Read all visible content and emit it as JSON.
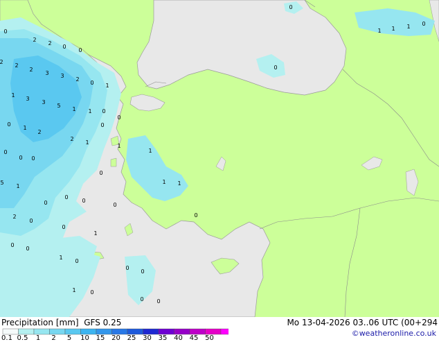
{
  "legend": {
    "title": "Precipitation [mm]",
    "model": "GFS 0.25",
    "valid_time": "Mo 13-04-2026 03..06 UTC (00+294",
    "credit": "©weatheronline.co.uk",
    "ticks": [
      "0.1",
      "0.5",
      "1",
      "2",
      "5",
      "10",
      "15",
      "20",
      "25",
      "30",
      "35",
      "40",
      "45",
      "50"
    ],
    "colors": [
      "#f5fafa",
      "#b4f0f0",
      "#96e6f0",
      "#78d7f0",
      "#5ac8f0",
      "#3cb4f0",
      "#3296eb",
      "#2878e6",
      "#1e5adc",
      "#1e28d2",
      "#6e00d2",
      "#9600c8",
      "#be00c8",
      "#e600c8",
      "#ff00ff"
    ]
  },
  "map": {
    "land_color": "#ccff99",
    "sea_color": "#e8e8e8",
    "value_labels": [
      {
        "text": "0"
      },
      {
        "text": "2"
      },
      {
        "text": "2"
      },
      {
        "text": "0"
      },
      {
        "text": "0"
      },
      {
        "text": "2"
      },
      {
        "text": "2"
      },
      {
        "text": "2"
      },
      {
        "text": "3"
      },
      {
        "text": "3"
      },
      {
        "text": "2"
      },
      {
        "text": "1"
      },
      {
        "text": "3"
      },
      {
        "text": "3"
      },
      {
        "text": "5"
      },
      {
        "text": "1"
      },
      {
        "text": "0"
      },
      {
        "text": "1"
      },
      {
        "text": "1"
      },
      {
        "text": "0"
      },
      {
        "text": "0"
      },
      {
        "text": "1"
      },
      {
        "text": "2"
      },
      {
        "text": "2"
      },
      {
        "text": "1"
      },
      {
        "text": "0"
      },
      {
        "text": "1"
      },
      {
        "text": "0"
      },
      {
        "text": "1"
      },
      {
        "text": "0"
      },
      {
        "text": "5"
      },
      {
        "text": "1"
      },
      {
        "text": "0"
      },
      {
        "text": "0"
      },
      {
        "text": "0"
      },
      {
        "text": "0"
      },
      {
        "text": "0"
      },
      {
        "text": "0"
      },
      {
        "text": "2"
      },
      {
        "text": "0"
      },
      {
        "text": "0"
      },
      {
        "text": "0"
      },
      {
        "text": "1"
      },
      {
        "text": "0"
      },
      {
        "text": "0"
      },
      {
        "text": "1"
      },
      {
        "text": "0"
      },
      {
        "text": "0"
      },
      {
        "text": "0"
      },
      {
        "text": "0"
      },
      {
        "text": "0"
      },
      {
        "text": "0"
      },
      {
        "text": "1"
      },
      {
        "text": "1"
      },
      {
        "text": "1"
      },
      {
        "text": "0"
      },
      {
        "text": "0"
      },
      {
        "text": "0"
      }
    ]
  }
}
